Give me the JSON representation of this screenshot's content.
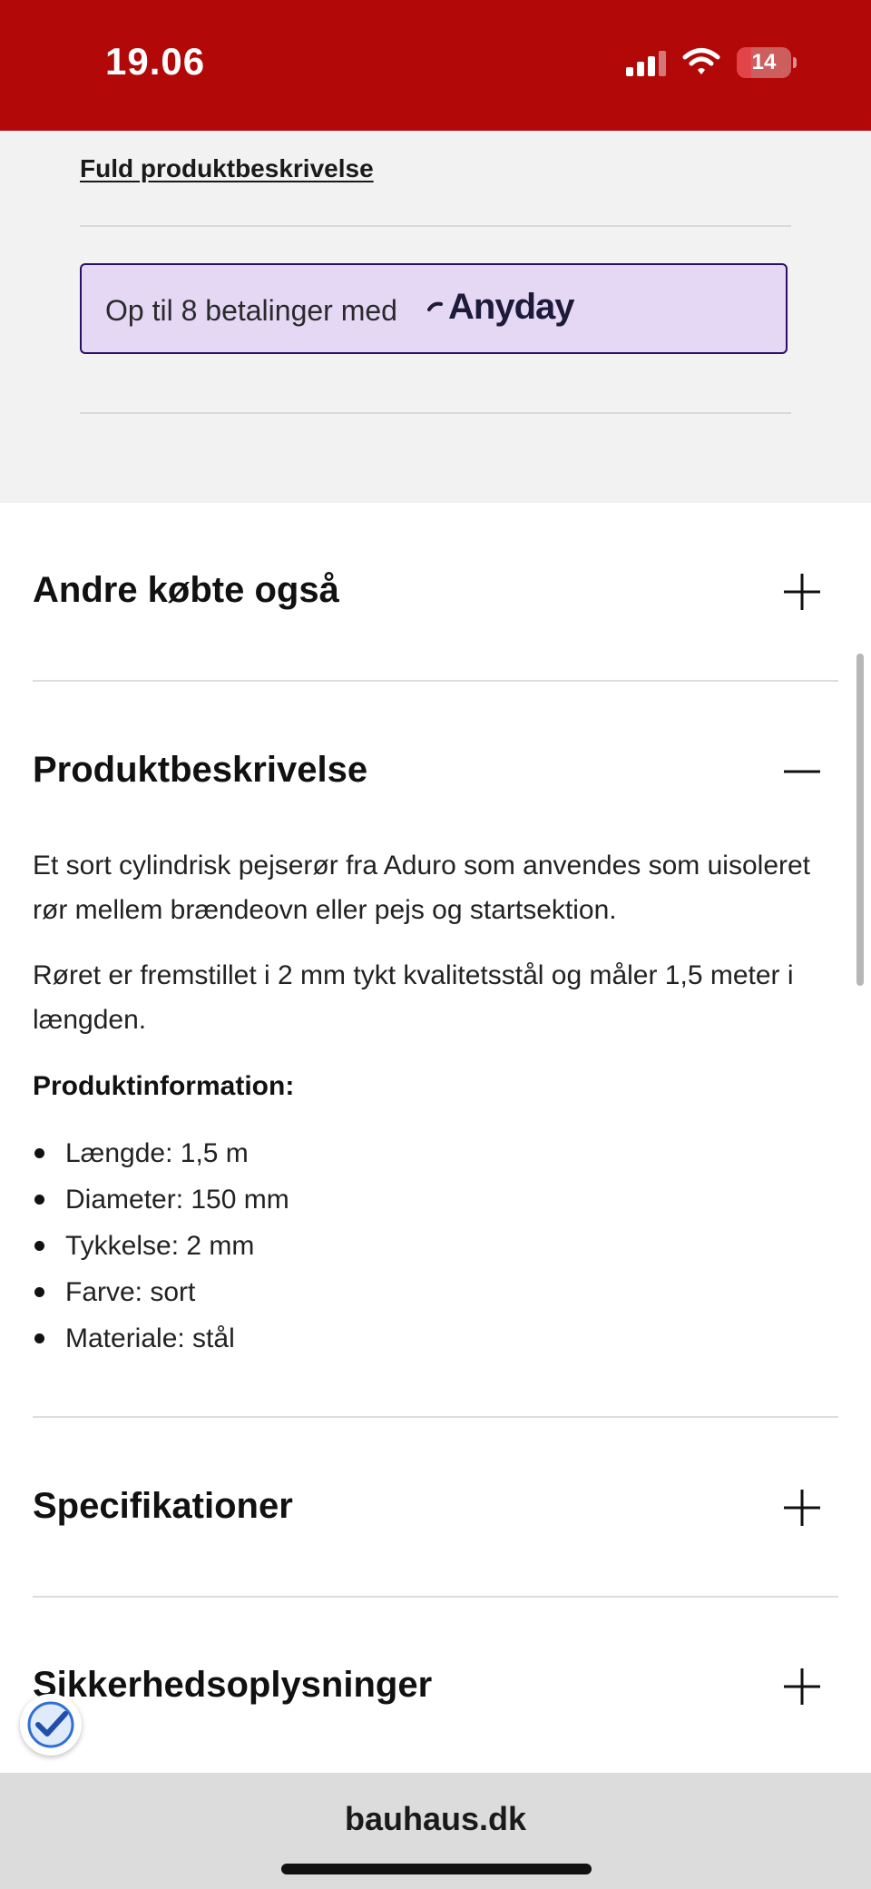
{
  "status_bar": {
    "time": "19.06",
    "battery": "14",
    "battery_level_percent": 14
  },
  "top_section": {
    "full_description_link": "Fuld produktbeskrivelse",
    "anyday_banner": {
      "text": "Op til 8 betalinger med",
      "logo_text": "Anyday"
    }
  },
  "sections": {
    "others_bought": {
      "title": "Andre købte også",
      "state": "collapsed"
    },
    "product_description": {
      "title": "Produktbeskrivelse",
      "state": "expanded",
      "paragraph_1": "Et sort cylindrisk pejserør fra Aduro som anvendes som uisoleret rør mellem brændeovn eller pejs og startsektion.",
      "paragraph_2": "Røret er fremstillet i 2 mm tykt kvalitetsstål og måler 1,5 meter i længden.",
      "info_heading": "Produktinformation:",
      "bullets": [
        "Længde: 1,5 m",
        "Diameter: 150 mm",
        "Tykkelse: 2 mm",
        "Farve: sort",
        "Materiale: stål"
      ]
    },
    "specifications": {
      "title": "Specifikationer",
      "state": "collapsed"
    },
    "safety_info": {
      "title": "Sikkerhedsoplysninger",
      "state": "collapsed"
    }
  },
  "browser": {
    "url": "bauhaus.dk"
  },
  "icons": {
    "expand": "plus-icon",
    "collapse": "minus-icon",
    "badge": "verified-check-icon"
  },
  "colors": {
    "status_bar_bg": "#b30808",
    "anyday_bg": "#e4d8f5",
    "anyday_border": "#2a0f66",
    "badge_blue": "#2f6fd6"
  }
}
